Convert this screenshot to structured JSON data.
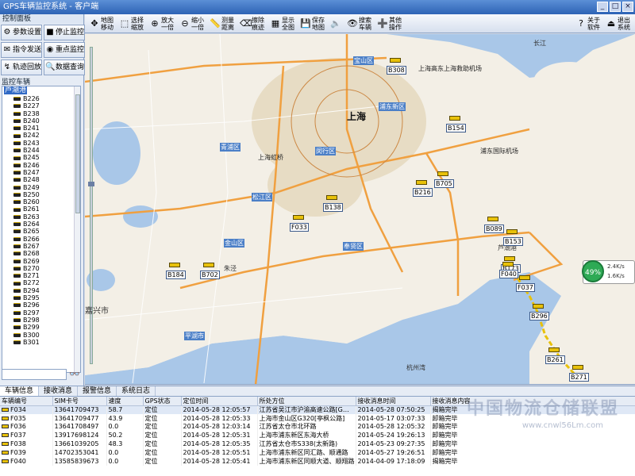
{
  "window": {
    "title": "GPS车辆监控系统 - 客户端"
  },
  "control_panel": {
    "header": "控制面板",
    "buttons": [
      {
        "label": "参数设置",
        "icon": "gear-icon",
        "glyph": "⚙"
      },
      {
        "label": "停止监控",
        "icon": "stop-icon",
        "glyph": "■"
      },
      {
        "label": "指令发送",
        "icon": "send-icon",
        "glyph": "✉"
      },
      {
        "label": "重点监控",
        "icon": "focus-icon",
        "glyph": "◉"
      },
      {
        "label": "轨迹回放",
        "icon": "playback-icon",
        "glyph": "↯"
      },
      {
        "label": "数据查询",
        "icon": "query-icon",
        "glyph": "🔍"
      }
    ]
  },
  "vehicle_tree": {
    "title": "监控车辆",
    "root": "芦潮港",
    "items": [
      "B226",
      "B227",
      "B238",
      "B240",
      "B241",
      "B242",
      "B243",
      "B244",
      "B245",
      "B246",
      "B247",
      "B248",
      "B249",
      "B250",
      "B260",
      "B261",
      "B263",
      "B264",
      "B265",
      "B266",
      "B267",
      "B268",
      "B269",
      "B270",
      "B271",
      "B272",
      "B294",
      "B295",
      "B296",
      "B297",
      "B298",
      "B299",
      "B300",
      "B301"
    ]
  },
  "toolbar": {
    "buttons": [
      {
        "l1": "地图",
        "l2": "移动",
        "icon": "move-icon",
        "glyph": "✥"
      },
      {
        "l1": "选择",
        "l2": "缩放",
        "icon": "select-zoom-icon",
        "glyph": "⬚"
      },
      {
        "l1": "放大",
        "l2": "一倍",
        "icon": "zoom-in-icon",
        "glyph": "⊕"
      },
      {
        "l1": "缩小",
        "l2": "一倍",
        "icon": "zoom-out-icon",
        "glyph": "⊖"
      },
      {
        "l1": "测量",
        "l2": "距离",
        "icon": "measure-icon",
        "glyph": "📏"
      },
      {
        "l1": "擦除",
        "l2": "痕迹",
        "icon": "erase-icon",
        "glyph": "⌫"
      },
      {
        "l1": "显示",
        "l2": "全图",
        "icon": "fullmap-icon",
        "glyph": "▦"
      },
      {
        "l1": "保存",
        "l2": "地图",
        "icon": "save-icon",
        "glyph": "💾"
      },
      {
        "l1": "",
        "l2": "",
        "icon": "sound-icon",
        "glyph": "🔈"
      },
      {
        "l1": "搜索",
        "l2": "车辆",
        "icon": "search-vehicle-icon",
        "glyph": "👁"
      },
      {
        "l1": "其他",
        "l2": "操作",
        "icon": "other-ops-icon",
        "glyph": "➕"
      }
    ],
    "right": [
      {
        "l1": "关于",
        "l2": "软件",
        "icon": "about-icon",
        "glyph": "?"
      },
      {
        "l1": "退出",
        "l2": "系统",
        "icon": "exit-icon",
        "glyph": "⏏"
      }
    ]
  },
  "map": {
    "city": "上海",
    "labels": [
      "嘉兴市",
      "上海虹桥",
      "浦东国际机场",
      "上海高东上海救助机场",
      "长江",
      "杭州湾",
      "平湖市",
      "朱泾",
      "青浦区",
      "松江区",
      "闵行区",
      "奉贤区",
      "宝山区",
      "浦东新区",
      "金山区",
      "芦潮港"
    ],
    "vehicles": [
      "B308",
      "B154",
      "B705",
      "B216",
      "B138",
      "F033",
      "B184",
      "B702",
      "B089",
      "B153",
      "B173",
      "F040",
      "F037",
      "B296",
      "B261",
      "B271"
    ],
    "speedo": {
      "pct": "49%",
      "row1": "2.4K/s",
      "row2": "1.6K/s"
    }
  },
  "bottom": {
    "tabs": [
      "车辆信息",
      "接收消息",
      "报警信息",
      "系统日志"
    ],
    "columns": [
      "车辆编号",
      "SIM卡号",
      "速度",
      "GPS状态",
      "定位时间",
      "所处方位",
      "接收消息时间",
      "接收消息内容"
    ],
    "rows": [
      [
        "F034",
        "13641709473",
        "58.7",
        "定位",
        "2014-05-28 12:05:57",
        "江苏省吴江市沪渝高速公路[G…",
        "2014-05-28 07:50:25",
        "揭箱完毕"
      ],
      [
        "F035",
        "13641709477",
        "43.9",
        "定位",
        "2014-05-28 12:05:33",
        "上海市金山区G320[亭枫公路]",
        "2014-05-17 03:07:33",
        "卸箱完毕"
      ],
      [
        "F036",
        "13641708497",
        "0.0",
        "定位",
        "2014-05-28 12:03:14",
        "江苏省太仓市北环路",
        "2014-05-28 12:05:32",
        "卸箱完毕"
      ],
      [
        "F037",
        "13917698124",
        "50.2",
        "定位",
        "2014-05-28 12:05:31",
        "上海市浦东新区东海大桥",
        "2014-05-24 19:26:13",
        "卸箱完毕"
      ],
      [
        "F038",
        "13661039205",
        "48.3",
        "定位",
        "2014-05-28 12:05:35",
        "江苏省太仓市S338(太新路)",
        "2014-05-23 09:27:35",
        "卸箱完毕"
      ],
      [
        "F039",
        "14702353041",
        "0.0",
        "定位",
        "2014-05-28 12:05:51",
        "上海市浦东新区同汇路、顺通路",
        "2014-05-27 19:26:51",
        "卸箱完毕"
      ],
      [
        "F040",
        "13585839673",
        "0.0",
        "定位",
        "2014-05-28 12:05:41",
        "上海市浦东新区同顺大道、顺翔路",
        "2014-04-09 17:18:09",
        "揭箱完毕"
      ]
    ],
    "watermark": "中国物流仓储联盟",
    "watermark_url": "www.cnwl56Lm.com"
  },
  "colors": {
    "title_bar": "#2d63b5",
    "water": "#a9c7e8",
    "land": "#f3efe6",
    "highway": "#f0a040",
    "district": "#4b7fc7",
    "truck": "#e8c10a"
  }
}
